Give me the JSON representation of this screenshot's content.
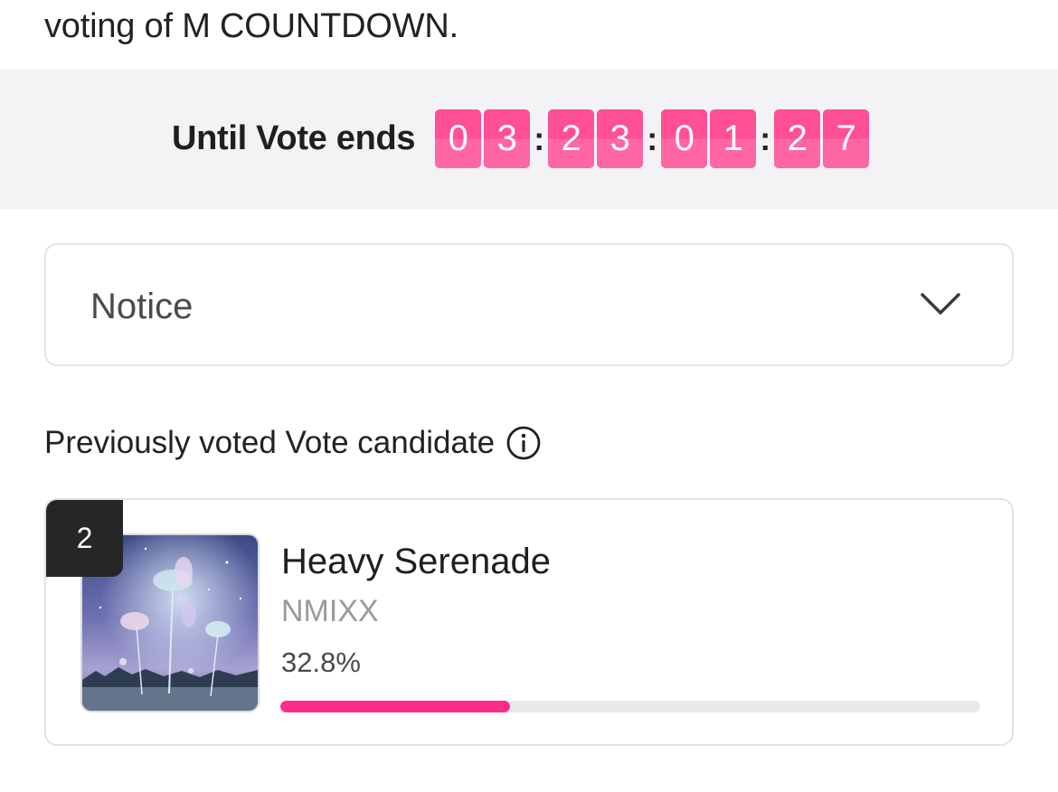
{
  "intro_text": "voting of M COUNTDOWN.",
  "countdown": {
    "label": "Until Vote ends",
    "digits": [
      "0",
      "3",
      "2",
      "3",
      "0",
      "1",
      "2",
      "7"
    ],
    "separator": ":"
  },
  "notice": {
    "label": "Notice",
    "icon": "chevron-down-icon"
  },
  "previous": {
    "label": "Previously voted Vote candidate",
    "icon": "info-icon"
  },
  "candidate": {
    "rank": "2",
    "title": "Heavy Serenade",
    "artist": "NMIXX",
    "percent_label": "32.8%",
    "percent_value": 32.8
  },
  "colors": {
    "accent": "#ff2d87",
    "digit_bg": "#ff4f95",
    "band_bg": "#f3f3f5"
  }
}
